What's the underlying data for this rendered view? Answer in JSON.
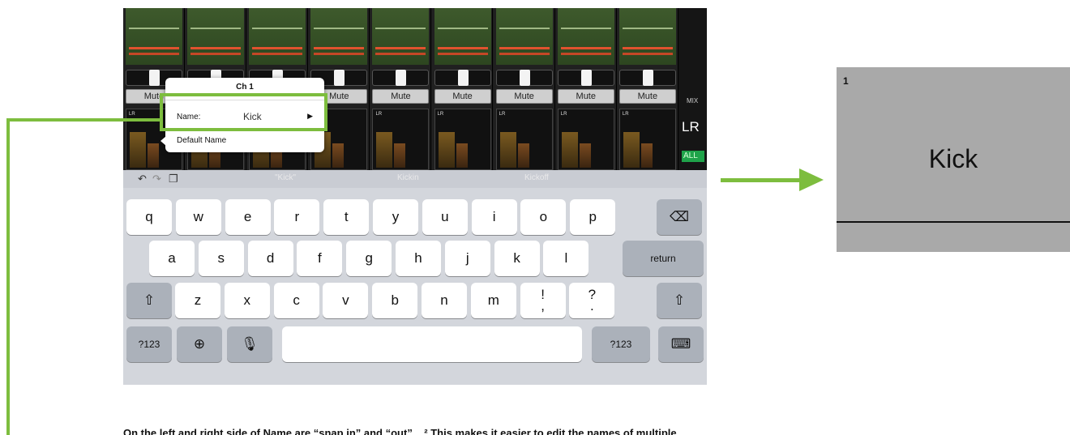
{
  "mixer": {
    "channels": [
      "Mute",
      "Mute",
      "Mute",
      "Mute",
      "Mute",
      "Mute",
      "Mute",
      "Mute",
      "Mute"
    ],
    "meter_label": "LR",
    "mix_label": "MIX",
    "master_label": "LR",
    "all_label": "ALL"
  },
  "popup": {
    "title": "Ch 1",
    "name_label": "Name:",
    "name_value": "Kick",
    "default_label": "Default Name"
  },
  "keyboard": {
    "suggestions": [
      "\"Kick\"",
      "Kickin",
      "Kickoff"
    ],
    "row1": [
      "q",
      "w",
      "e",
      "r",
      "t",
      "y",
      "u",
      "i",
      "o",
      "p"
    ],
    "row2": [
      "a",
      "s",
      "d",
      "f",
      "g",
      "h",
      "j",
      "k",
      "l"
    ],
    "row3": [
      "z",
      "x",
      "c",
      "v",
      "b",
      "n",
      "m",
      "!\n,",
      "?\n."
    ],
    "return_label": "return",
    "numbers_label": "?123",
    "icons": [
      "undo-icon",
      "redo-icon",
      "paste-icon",
      "delete-icon",
      "shift-icon",
      "globe-icon",
      "microphone-icon",
      "keyboard-dismiss-icon"
    ]
  },
  "zoom": {
    "channel_number": "1",
    "channel_name": "Kick"
  },
  "caption": "On the left and right side of Name are “snap in” and “out”... ² This makes it easier to edit the names of multiple",
  "colors": {
    "highlight": "#7dbd3e",
    "all_badge": "#1fa34a"
  }
}
